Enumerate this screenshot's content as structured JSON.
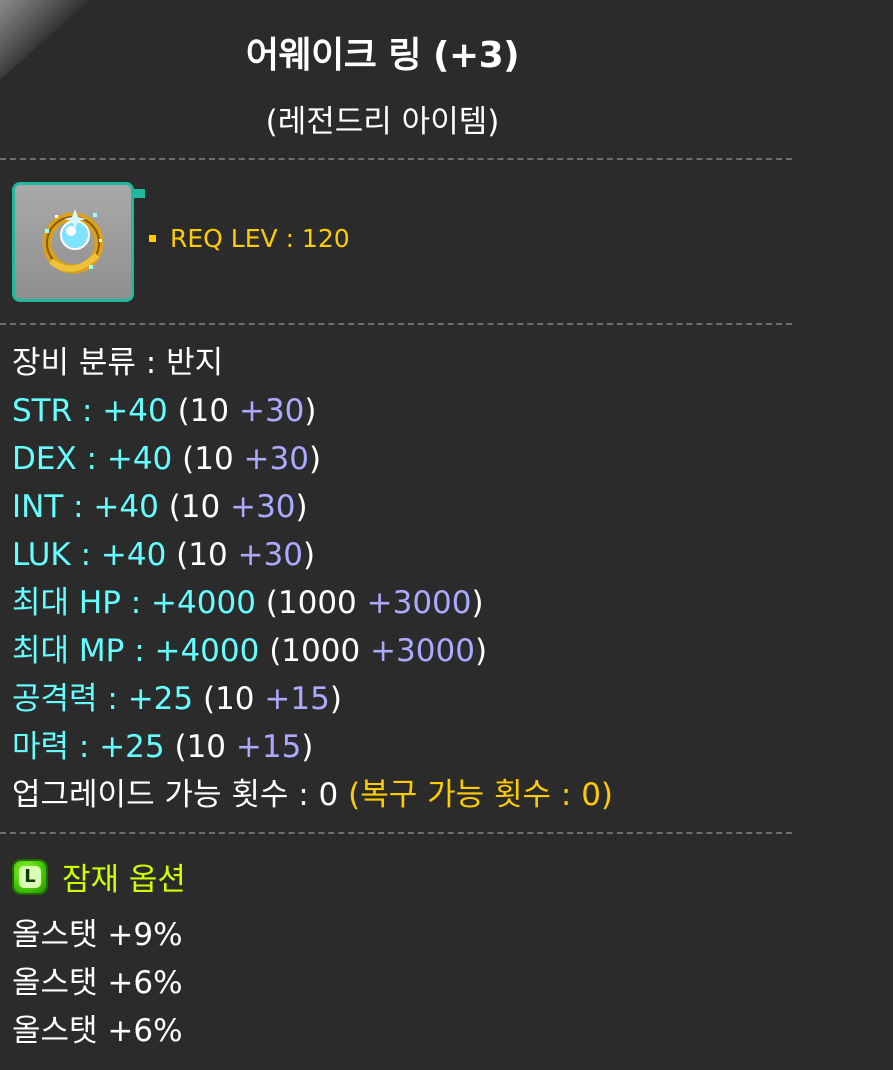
{
  "item": {
    "name": "어웨이크 링 (+3)",
    "grade": "(레전드리 아이템)",
    "icon": "awake-ring-icon",
    "req_level": "REQ LEV : 120"
  },
  "stats": {
    "category": "장비 분류 : 반지",
    "str": {
      "label": "STR : +40",
      "base": " (10 ",
      "bonus": "+30",
      "close": ")"
    },
    "dex": {
      "label": "DEX : +40",
      "base": " (10 ",
      "bonus": "+30",
      "close": ")"
    },
    "int": {
      "label": "INT : +40",
      "base": " (10 ",
      "bonus": "+30",
      "close": ")"
    },
    "luk": {
      "label": "LUK : +40",
      "base": " (10 ",
      "bonus": "+30",
      "close": ")"
    },
    "hp": {
      "label": "최대 HP : +4000",
      "base": " (1000 ",
      "bonus": "+3000",
      "close": ")"
    },
    "mp": {
      "label": "최대 MP : +4000",
      "base": " (1000 ",
      "bonus": "+3000",
      "close": ")"
    },
    "atk": {
      "label": "공격력 : +25",
      "base": " (10 ",
      "bonus": "+15",
      "close": ")"
    },
    "matk": {
      "label": "마력 : +25",
      "base": " (10 ",
      "bonus": "+15",
      "close": ")"
    },
    "upgrades": "업그레이드 가능 횟수 : 0 ",
    "restore": "(복구 가능 횟수 : 0)"
  },
  "potential": {
    "badge_letter": "L",
    "title": "잠재 옵션",
    "lines": [
      "올스탯 +9%",
      "올스탯 +6%",
      "올스탯 +6%"
    ]
  },
  "colors": {
    "background": "#2b2b2b",
    "stat": "#66ffff",
    "bonus": "#aaaaff",
    "gold": "#ffcc00",
    "potential_title": "#ccff00",
    "frame": "#1fb9a0"
  }
}
